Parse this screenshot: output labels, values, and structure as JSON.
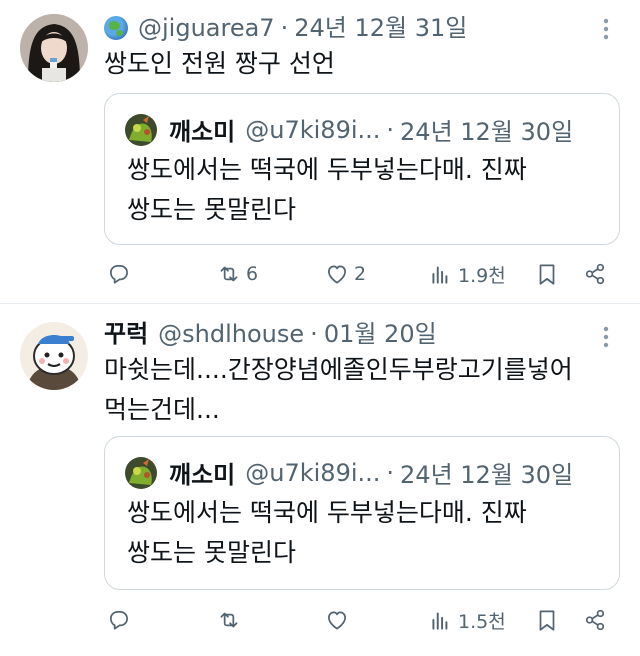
{
  "tweets": [
    {
      "display_name": "",
      "handle": "@jiguarea7",
      "separator": "·",
      "date": "24년 12월 31일",
      "text_lines": [
        "쌍도인 전원 짱구 선언"
      ],
      "quote": {
        "display_name": "깨소미",
        "handle": "@u7ki89i...",
        "separator": "·",
        "date": "24년 12월 30일",
        "text_lines": [
          "쌍도에서는 떡국에 두부넣는다매. 진짜",
          "쌍도는 못말린다"
        ]
      },
      "actions": {
        "reply": "",
        "retweet": "6",
        "like": "2",
        "views": "1.9천"
      }
    },
    {
      "display_name": "꾸럭",
      "handle": "@shdlhouse",
      "separator": "·",
      "date": "01월 20일",
      "text_lines": [
        "마쉿는데....간장양념에졸인두부랑고기를넣어",
        "먹는건데..."
      ],
      "quote": {
        "display_name": "깨소미",
        "handle": "@u7ki89i...",
        "separator": "·",
        "date": "24년 12월 30일",
        "text_lines": [
          "쌍도에서는 떡국에 두부넣는다매. 진짜",
          "쌍도는 못말린다"
        ]
      },
      "actions": {
        "reply": "",
        "retweet": "",
        "like": "",
        "views": "1.5천"
      }
    }
  ],
  "icons": {
    "emoji_name": "globe-emoji-icon",
    "more": "more-vertical-icon",
    "reply": "reply-icon",
    "retweet": "retweet-icon",
    "like": "heart-icon",
    "views": "views-icon",
    "bookmark": "bookmark-icon",
    "share": "share-icon"
  },
  "colors": {
    "text": "#0f1419",
    "secondary": "#536471",
    "border": "#cfd9de"
  }
}
